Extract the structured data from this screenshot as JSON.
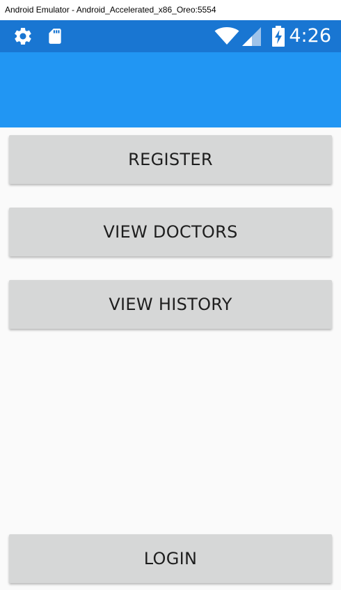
{
  "window": {
    "title": "Android Emulator - Android_Accelerated_x86_Oreo:5554"
  },
  "status_bar": {
    "time": "4:26",
    "icons": [
      "gear-icon",
      "sdcard-icon",
      "wifi-icon",
      "signal-icon",
      "battery-charging-icon"
    ],
    "color": "#1976d2"
  },
  "app_bar": {
    "color": "#2196f3"
  },
  "buttons": {
    "register": "REGISTER",
    "view_doctors": "VIEW DOCTORS",
    "view_history": "VIEW HISTORY",
    "login": "LOGIN"
  }
}
